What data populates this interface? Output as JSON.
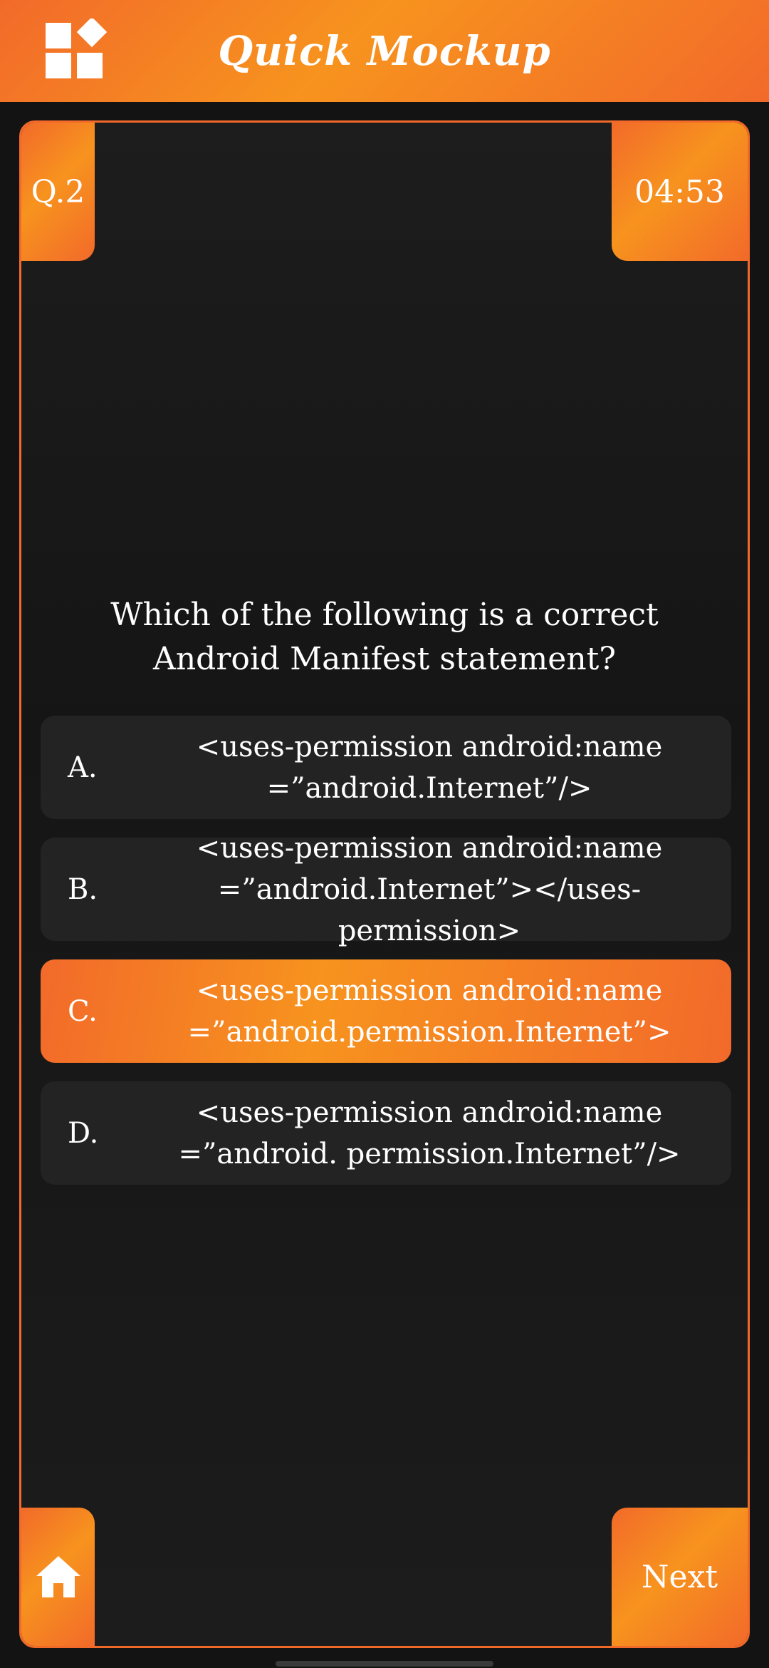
{
  "app_bar": {
    "title": "Quick Mockup",
    "logo_icon": "widgets-icon"
  },
  "quiz": {
    "question_number": "Q.2",
    "timer": "04:53",
    "question": "Which of the following is a correct Android Manifest statement?",
    "options": [
      {
        "letter": "A.",
        "text": "<uses-permission android:name\n=”android.Internet”/>",
        "selected": false
      },
      {
        "letter": "B.",
        "text": "<uses-permission android:name\n=”android.Internet”></uses-permission>",
        "selected": false
      },
      {
        "letter": "C.",
        "text": "<uses-permission android:name\n=”android.permission.Internet”>",
        "selected": true
      },
      {
        "letter": "D.",
        "text": "<uses-permission android:name\n=”android. permission.Internet”/>",
        "selected": false
      }
    ],
    "home_icon": "home-icon",
    "next_label": "Next"
  },
  "colors": {
    "accent": "#F26A2A",
    "accent_light": "#F7931E",
    "background": "#131313",
    "option_bg": "#232323"
  }
}
